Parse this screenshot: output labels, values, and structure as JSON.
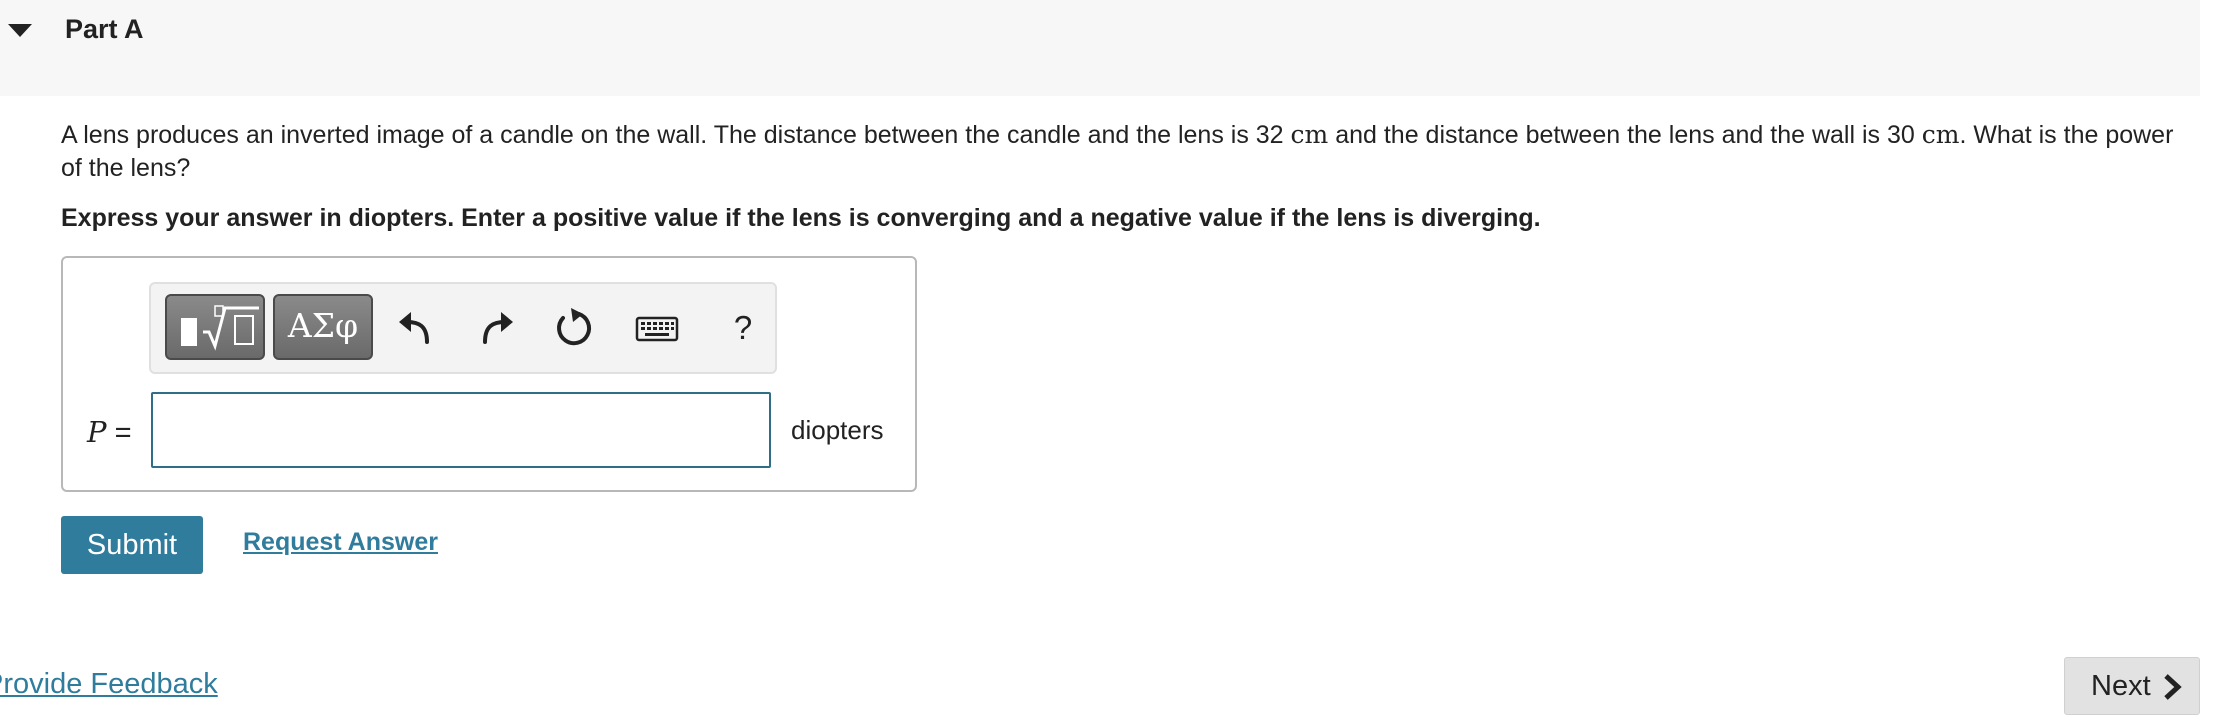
{
  "part": {
    "title": "Part A"
  },
  "question": {
    "text_1": "A lens produces an inverted image of a candle on the wall. The distance between the candle and the lens is 32 ",
    "unit_1": "cm",
    "text_2": " and the distance between the lens and the wall is 30 ",
    "unit_2": "cm",
    "text_3": ". What is the power of the lens?",
    "instruction": "Express your answer in diopters. Enter a positive value if the lens is converging and a negative value if the lens is diverging."
  },
  "toolbar": {
    "greek_label": "ΑΣφ",
    "help_label": "?",
    "icons": [
      "templates-icon",
      "greek-letters-icon",
      "undo-icon",
      "redo-icon",
      "reset-icon",
      "keyboard-icon",
      "help-icon"
    ]
  },
  "answer": {
    "variable": "P",
    "equals": " =",
    "value": "",
    "placeholder": "",
    "units": "diopters"
  },
  "actions": {
    "submit_label": "Submit",
    "request_answer_label": "Request Answer"
  },
  "footer": {
    "feedback_label": "Provide Feedback",
    "next_label": "Next"
  },
  "colors": {
    "accent": "#2f7c9c",
    "input_border": "#2f6f86",
    "header_bg": "#f7f7f7"
  }
}
